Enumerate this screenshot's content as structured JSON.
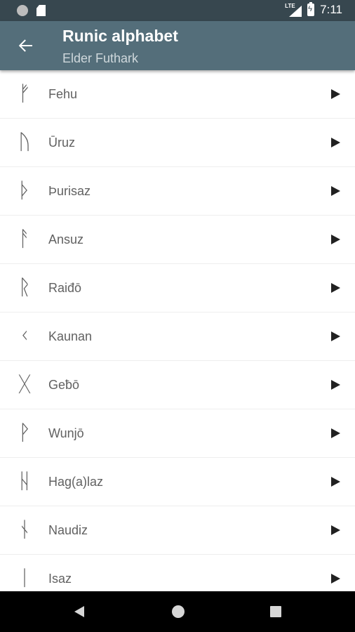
{
  "status_bar": {
    "network": "LTE",
    "time": "7:11"
  },
  "header": {
    "title": "Runic alphabet",
    "subtitle": "Elder Futhark"
  },
  "runes": [
    {
      "glyph": "ᚠ",
      "name": "Fehu"
    },
    {
      "glyph": "ᚢ",
      "name": "Ūruz"
    },
    {
      "glyph": "ᚦ",
      "name": "Þurisaz"
    },
    {
      "glyph": "ᚨ",
      "name": "Ansuz"
    },
    {
      "glyph": "ᚱ",
      "name": "Raiđō"
    },
    {
      "glyph": "ᚲ",
      "name": "Kaunan"
    },
    {
      "glyph": "ᚷ",
      "name": "Geƀō"
    },
    {
      "glyph": "ᚹ",
      "name": "Wunjō"
    },
    {
      "glyph": "ᚺ",
      "name": "Hag(a)laz"
    },
    {
      "glyph": "ᚾ",
      "name": "Naudiz"
    },
    {
      "glyph": "ᛁ",
      "name": "Isaz"
    }
  ],
  "icons": {
    "back": "arrow-back-icon",
    "row_action": "play-icon",
    "nav": [
      "nav-back-icon",
      "nav-home-icon",
      "nav-recents-icon"
    ]
  },
  "colors": {
    "status_bar": "#37474f",
    "app_bar": "#546e7a",
    "row_text": "#616161",
    "play": "#212121"
  }
}
